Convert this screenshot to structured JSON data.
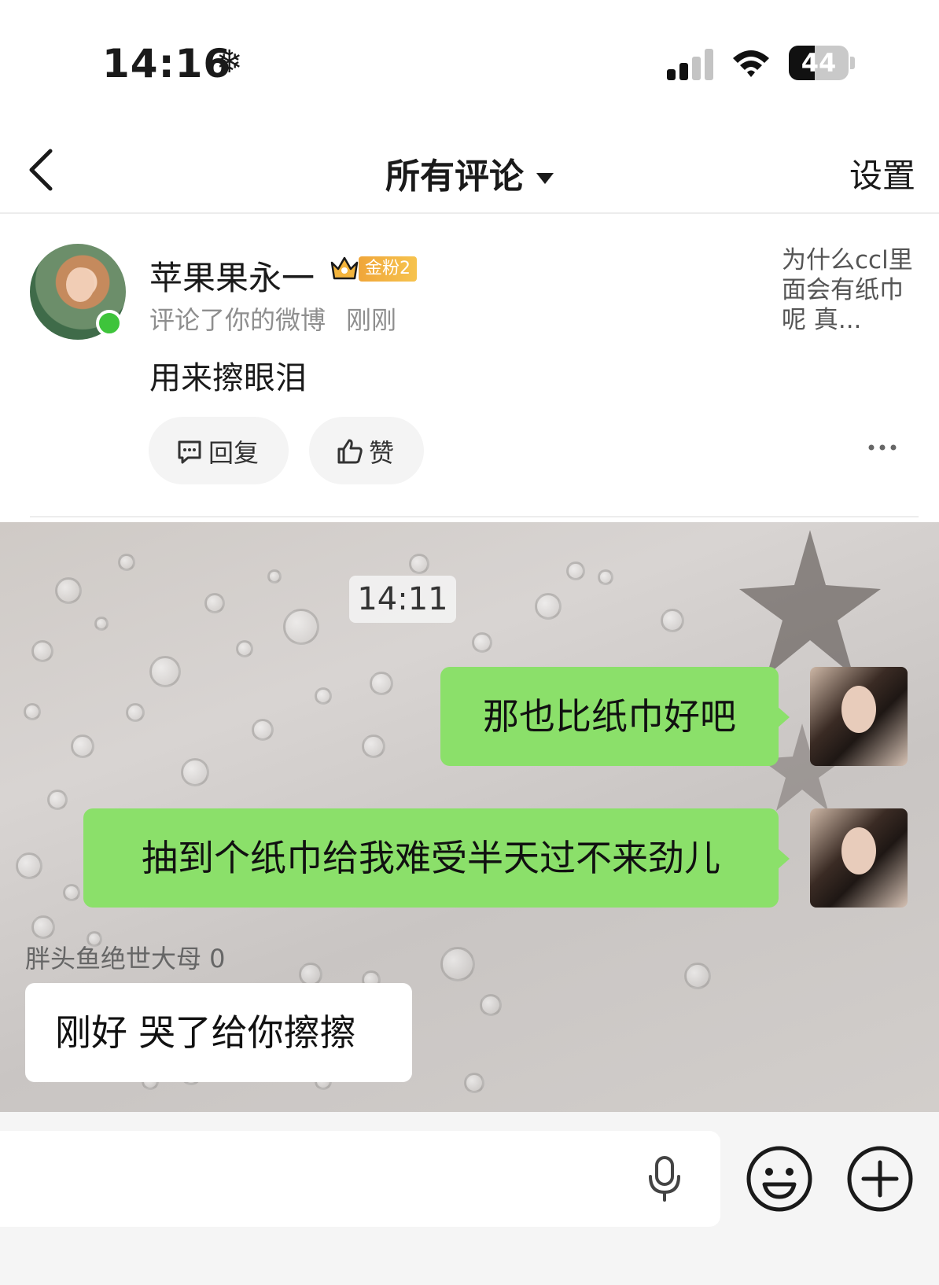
{
  "status_bar": {
    "time": "14:16",
    "snow_glyph": "❄",
    "battery": "44",
    "battery_level": 0.44
  },
  "nav": {
    "title": "所有评论",
    "settings": "设置"
  },
  "comment": {
    "user_name": "苹果果永一",
    "fan_badge": "金粉2",
    "action": "评论了你的微博",
    "time": "刚刚",
    "text": "用来擦眼泪",
    "quoted_post": "为什么ccl里面会有纸巾呢 真...",
    "reply_label": "回复",
    "like_label": "赞"
  },
  "screenshot": {
    "time_chip": "14:11",
    "messages_self": [
      "那也比纸巾好吧",
      "抽到个纸巾给我难受半天过不来劲儿"
    ],
    "sender_name": "胖头鱼绝世大母 0",
    "message_other": "刚好 哭了给你擦擦"
  },
  "colors": {
    "bubble_green": "#8be06a",
    "online_dot": "#3ec43b",
    "badge_gold": "#f0a63a"
  }
}
